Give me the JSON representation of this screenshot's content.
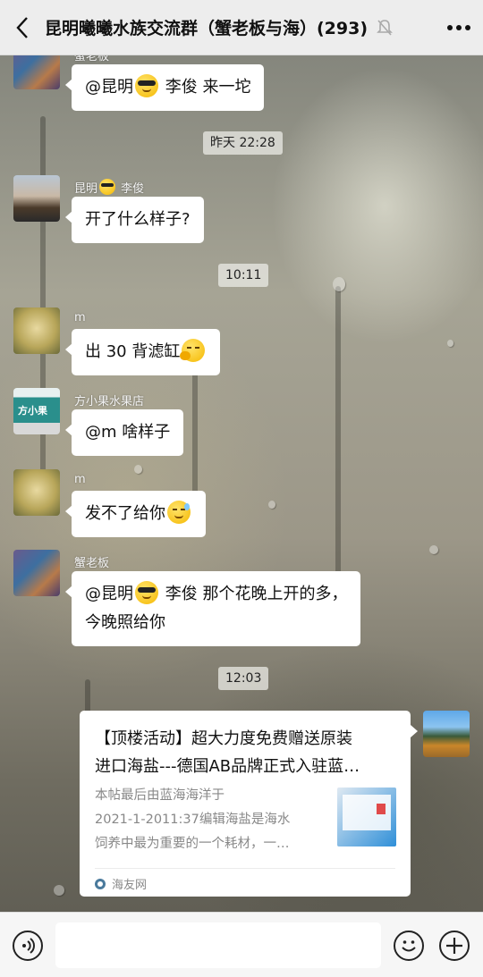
{
  "header": {
    "title": "昆明曦曦水族交流群（蟹老板与海）(293)",
    "back_icon": "chevron-left-icon",
    "mute_icon": "bell-muted-icon",
    "more_icon": "more-dots-icon"
  },
  "messages": [
    {
      "sender": "蟹老板",
      "text_parts": [
        "@昆明",
        "李俊  来一坨"
      ],
      "emoji": "sunglasses"
    },
    {
      "timestamp": "昨天 22:28"
    },
    {
      "sender_parts": [
        "昆明",
        "李俊"
      ],
      "text": "开了什么样子?"
    },
    {
      "timestamp": "10:11"
    },
    {
      "sender": "m",
      "text": "出 30 背滤缸",
      "emoji": "thinking"
    },
    {
      "sender": "方小果水果店",
      "text": "@m  啥样子",
      "avatar_text": "方小果"
    },
    {
      "sender": "m",
      "text": "发不了给你",
      "emoji": "sweat"
    },
    {
      "sender": "蟹老板",
      "lines": [
        "@昆明",
        "李俊  那个花晚上开的多，",
        "今晚照给你"
      ]
    },
    {
      "timestamp": "12:03"
    }
  ],
  "link_card": {
    "title_lines": [
      "【顶楼活动】超大力度免费赠送原装",
      "进口海盐---德国AB品牌正式入驻蓝…"
    ],
    "desc_lines": [
      "本帖最后由蓝海海洋于",
      "2021-1-2011:37编辑海盐是海水",
      "饲养中最为重要的一个耗材，一…"
    ],
    "source": "海友网"
  },
  "bottom_bar": {
    "voice_icon": "voice-icon",
    "input_value": "",
    "emoji_icon": "smiley-icon",
    "plus_icon": "plus-icon"
  },
  "colors": {
    "header_bg": "#ededed",
    "bubble_bg": "#ffffff",
    "bottom_bg": "#f6f6f6"
  }
}
